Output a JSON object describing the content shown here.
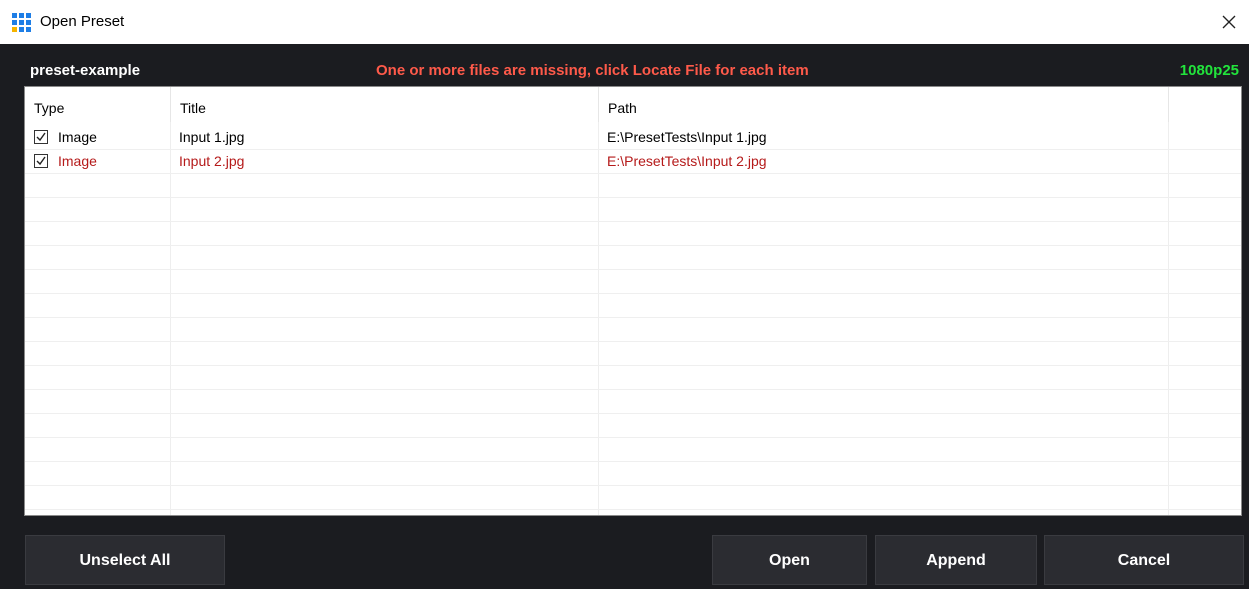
{
  "window": {
    "title": "Open Preset"
  },
  "header": {
    "preset_name": "preset-example",
    "warning": "One or more files are missing, click Locate File for each item",
    "format": "1080p25"
  },
  "table": {
    "columns": [
      "Type",
      "Title",
      "Path"
    ],
    "rows": [
      {
        "checked": true,
        "type": "Image",
        "title": "Input 1.jpg",
        "path": "E:\\PresetTests\\Input 1.jpg",
        "missing": false
      },
      {
        "checked": true,
        "type": "Image",
        "title": "Input 2.jpg",
        "path": "E:\\PresetTests\\Input 2.jpg",
        "missing": true
      }
    ]
  },
  "buttons": {
    "unselect_all": "Unselect All",
    "open": "Open",
    "append": "Append",
    "cancel": "Cancel"
  },
  "colors": {
    "warning": "#ff5a4a",
    "format": "#22e43c",
    "missing_text": "#b51a1a",
    "icon_blue": "#1e7ee6",
    "icon_yellow": "#f5b400"
  }
}
